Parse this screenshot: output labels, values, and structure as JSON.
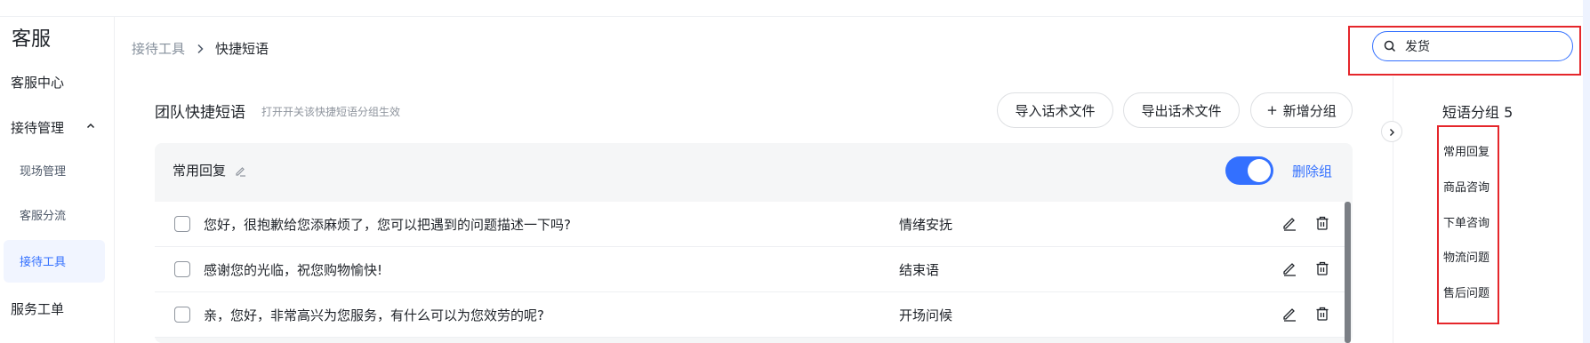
{
  "sidebar": {
    "app_title": "客服",
    "items": [
      {
        "label": "客服中心"
      },
      {
        "label": "接待管理"
      },
      {
        "label": "现场管理"
      },
      {
        "label": "客服分流"
      },
      {
        "label": "接待工具"
      },
      {
        "label": "服务工单"
      }
    ]
  },
  "breadcrumb": {
    "parent": "接待工具",
    "current": "快捷短语"
  },
  "search": {
    "value": "发货"
  },
  "panel": {
    "title": "团队快捷短语",
    "subtitle": "打开开关该快捷短语分组生效",
    "buttons": {
      "import": "导入话术文件",
      "export": "导出话术文件",
      "add_group": "新增分组"
    }
  },
  "group": {
    "name": "常用回复",
    "enabled": true,
    "delete_label": "删除组",
    "rows": [
      {
        "text": "您好，很抱歉给您添麻烦了，您可以把遇到的问题描述一下吗?",
        "tag": "情绪安抚"
      },
      {
        "text": "感谢您的光临，祝您购物愉快!",
        "tag": "结束语"
      },
      {
        "text": "亲，您好，非常高兴为您服务，有什么可以为您效劳的呢?",
        "tag": "开场问候"
      }
    ]
  },
  "categories": {
    "title": "短语分组 5",
    "items": [
      "常用回复",
      "商品咨询",
      "下单咨询",
      "物流问题",
      "售后问题"
    ]
  },
  "colors": {
    "accent": "#3370ff",
    "highlight": "#e5262b"
  }
}
